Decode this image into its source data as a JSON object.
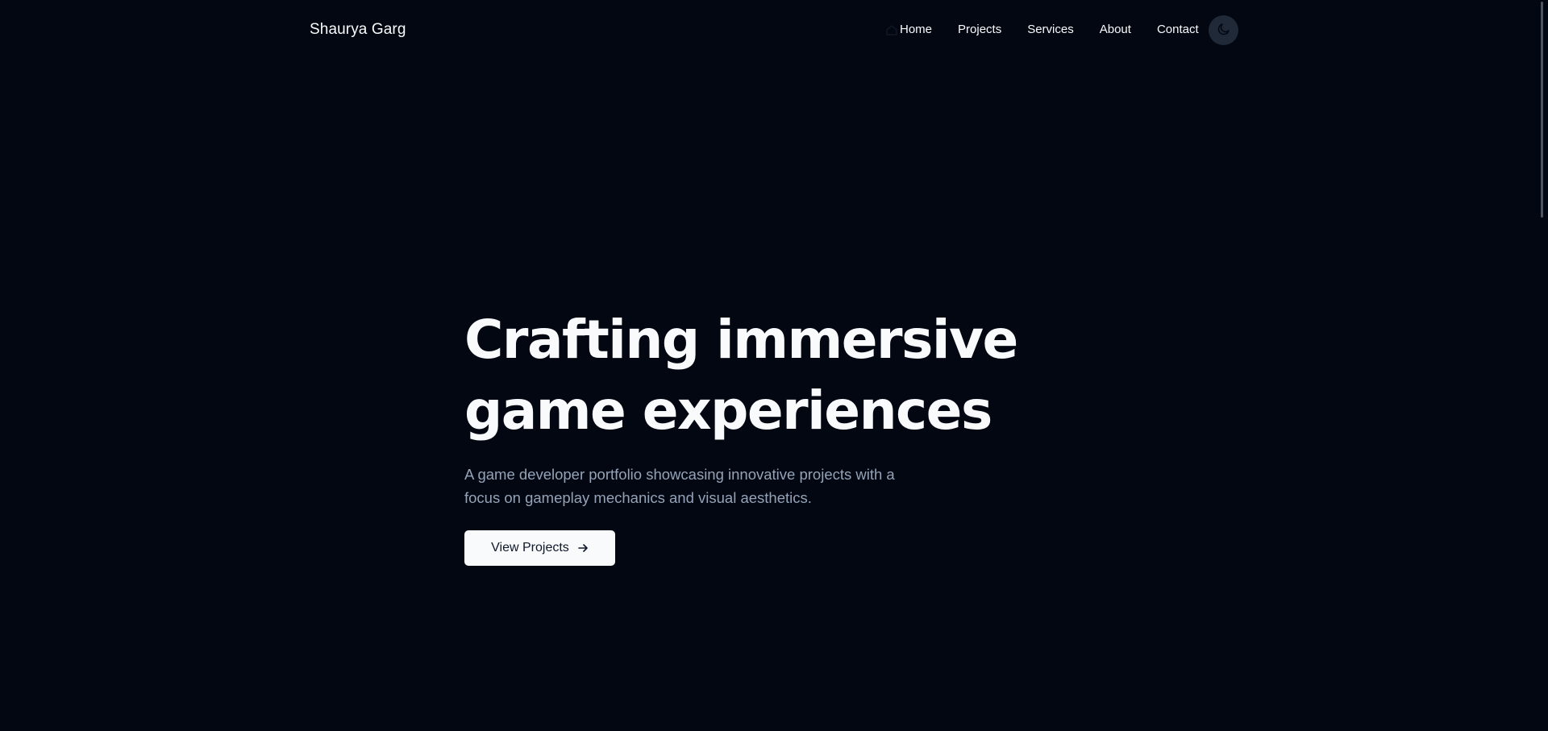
{
  "brand": "Shaurya Garg",
  "nav": {
    "items": [
      {
        "label": "Home",
        "icon": "home-icon"
      },
      {
        "label": "Projects"
      },
      {
        "label": "Services"
      },
      {
        "label": "About"
      },
      {
        "label": "Contact"
      }
    ],
    "theme_toggle_icon": "moon-icon"
  },
  "hero": {
    "title_line1": "Crafting immersive",
    "title_line2": "game experiences",
    "subtitle": "A game developer portfolio showcasing innovative projects with a focus on gameplay mechanics and visual aesthetics.",
    "cta_label": "View Projects",
    "cta_icon": "arrow-right-icon"
  },
  "colors": {
    "background": "#030712",
    "text": "#f8fafc",
    "muted": "#94a3b8",
    "toggle_bg": "#1f2937"
  }
}
